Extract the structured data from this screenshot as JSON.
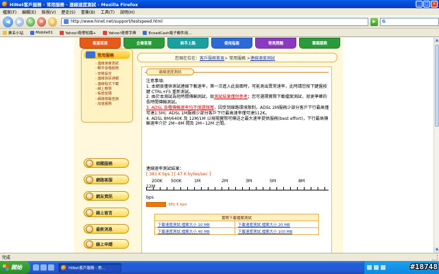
{
  "window": {
    "title": "HiNet客戶服務 - 常用服務 - 連線速度測試 - Mozilla Firefox",
    "min_glyph": "_",
    "max_glyph": "□",
    "close_glyph": "×"
  },
  "menubar": [
    "檔案(F)",
    "編輯(E)",
    "檢視(V)",
    "歷史(S)",
    "書簽(B)",
    "工具(T)",
    "說明(H)"
  ],
  "navbar": {
    "url": "http://www.hinet.net/support/testspeed.html",
    "go_glyph": "▶",
    "search_engine": "G"
  },
  "bookmarks": [
    "奧名小站",
    "Mobile01",
    "Yahoo!奇摩知識+",
    "Yahoo!奇摩字典",
    "EcoadCash電子郵件用…"
  ],
  "top_tabs": [
    {
      "label": "客服首頁",
      "color": "#e85a1a"
    },
    {
      "label": "企業客服",
      "color": "#2a9a3a"
    },
    {
      "label": "新手上路",
      "color": "#1aa0a0"
    },
    {
      "label": "使用指南",
      "color": "#2a6ad8"
    },
    {
      "label": "常見問題",
      "color": "#8a3ac0"
    },
    {
      "label": "專案服務",
      "color": "#2a9a3a"
    }
  ],
  "sidebar": {
    "service_title": "常用服務",
    "service_items": [
      "連線速度測試",
      "郵件信箱服務",
      "安裝設定",
      "連線資訊通報",
      "連線程式下載",
      "線上教學",
      "帳號密碼",
      "網路障礙查詢",
      "加值服務"
    ],
    "buttons": [
      "相關服務",
      "網路客服",
      "網友資訊",
      "線上留言",
      "最新消息",
      "線上申請"
    ]
  },
  "breadcrumb": {
    "prefix": "您現在位在：",
    "home": "客戶服務首頁",
    "sep1": " > 常用服務 > ",
    "current": "連線速度測試"
  },
  "section_tab": "連線速度測試",
  "notes": {
    "heading": "注意事項:",
    "n1": "1. 本網頁僅供測試連線下載速率，第一次進入此頁面時，可能測出異常速率，此時請您按下鍵盤按鍵 CTRL+F5 重新測試。",
    "n2a": "2. 由於本測試為短時間傳輸測試，故",
    "n2_link": "測試結果僅供參考",
    "n2b": "；您可選擇實際下載檔案測試，就更準確的長時間傳輸測試。",
    "n3a": "3. ADSL ",
    "n3_link": "各種傳輸速率均不保證頻寬",
    "n3b": "，因受到線路環境限制，ADSL 2M服務少部分客戶下行最高僅可達1.5M；ADSL 1M服務少部分客戶下行最高速率僅可達512K。",
    "n4": "4. ADSL 8M/640K 及 12M/1M 以現場實際可傳送之最大速率提供服務(best effort)，下行最高傳輸速率介於 2M~8M 間及 2M~12M 之間。"
  },
  "result": {
    "label": "連線速率測試結果：",
    "kbps": "[ 381 K bps ]",
    "kbytes": "[ 47 K bytes/sec ]"
  },
  "scale": {
    "labels": [
      "200K",
      "500K",
      "1M",
      "2M",
      "3M",
      "5M",
      "8M",
      "12M"
    ],
    "unit": "bps",
    "bar_text": "381 K bps",
    "bar_fraction": 0.11
  },
  "download_table": {
    "header": "實際下載檔案測試",
    "links": [
      "下載速度測試,檔案大小 10 MB",
      "下載速度測試,檔案大小 20 MB",
      "下載速度測試,檔案大小 40 MB",
      "下載速度測試,檔案大小 100 MB"
    ]
  },
  "statusbar": {
    "text": "完成"
  },
  "taskbar": {
    "start": "開始",
    "task_label": "HiNet客戶服務 - 常…",
    "watermark": "#18748"
  }
}
